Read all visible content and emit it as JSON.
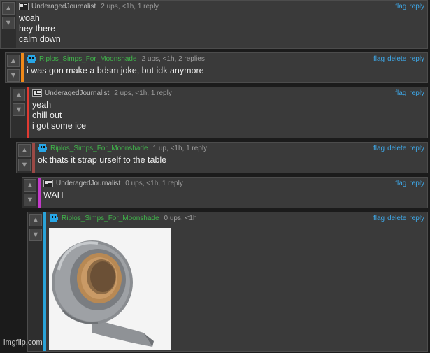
{
  "thread": {
    "actions_short": [
      "flag",
      "reply"
    ],
    "actions_long": [
      "flag",
      "delete",
      "reply"
    ],
    "comments": [
      {
        "user": "UnderagedJournalist",
        "meta": "2 ups, <1h, 1 reply",
        "lines": [
          "woah",
          "hey there",
          "calm down"
        ]
      },
      {
        "user": "Riplos_Simps_For_Moonshade",
        "meta": "2 ups, <1h, 2 replies",
        "lines": [
          "i was gon make a bdsm joke, but idk anymore"
        ],
        "accent": "#f08a1a"
      },
      {
        "user": "UnderagedJournalist",
        "meta": "2 ups, <1h, 1 reply",
        "lines": [
          "yeah",
          "chill out",
          "i got some ice"
        ],
        "accent": "#e03a32"
      },
      {
        "user": "Riplos_Simps_For_Moonshade",
        "meta": "1 up, <1h, 1 reply",
        "lines": [
          "ok thats it strap urself to the table"
        ],
        "accent": "#9a4a46"
      },
      {
        "user": "UnderagedJournalist",
        "meta": "0 ups, <1h, 1 reply",
        "lines": [
          "WAIT"
        ],
        "accent": "#c23ac8"
      },
      {
        "user": "Riplos_Simps_For_Moonshade",
        "meta": "0 ups, <1h",
        "lines": [],
        "accent": "#2aa3d8"
      }
    ]
  },
  "colors": {
    "background": "#1b1b1b",
    "panel": "#3a3a3a",
    "username_green": "#3fb54a",
    "link_blue": "#3ea8e8"
  },
  "icons": {
    "upvote": "arrow-up-icon",
    "downvote": "arrow-down-icon",
    "default_avatar": "journalist-avatar-icon",
    "custom_avatar": "pixel-avatar-icon"
  },
  "watermark": "imgflip.com"
}
